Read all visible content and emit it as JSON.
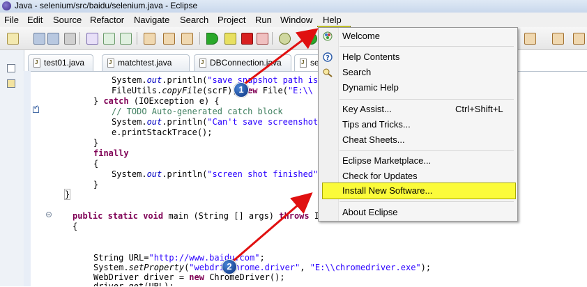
{
  "window": {
    "title": "Java - selenium/src/baidu/selenium.java - Eclipse"
  },
  "menubar": {
    "items": [
      "File",
      "Edit",
      "Source",
      "Refactor",
      "Navigate",
      "Search",
      "Project",
      "Run",
      "Window",
      "Help"
    ]
  },
  "tabs": [
    {
      "label": "test01.java"
    },
    {
      "label": "matchtest.java"
    },
    {
      "label": "DBConnection.java"
    },
    {
      "label": "sel"
    }
  ],
  "code": {
    "l1_a": "System.",
    "l1_b": "out",
    "l1_c": ".println(",
    "l1_d": "\"save snapshot path is:",
    "l2_a": "FileUtils.",
    "l2_b": "copyFile",
    "l2_c": "(scrF",
    "l2_d": "), ",
    "l2_e": "new",
    "l2_f": " File(",
    "l2_g": "\"E:\\\\",
    "l3_a": "} ",
    "l3_b": "catch",
    "l3_c": " (IOException e) {",
    "l4": "// TODO Auto-generated catch block",
    "l5_a": "System.",
    "l5_b": "out",
    "l5_c": ".println(",
    "l5_d": "\"Can't save screenshot\"",
    "l6": "e.printStackTrace();",
    "l7": "}",
    "l8": "finally",
    "l9": "{",
    "l10_a": "System.",
    "l10_b": "out",
    "l10_c": ".println(",
    "l10_d": "\"screen shot finished\"",
    "l10_e": ")",
    "l11": "}",
    "l12": "}",
    "l13_a": "public",
    "l13_b": "static",
    "l13_c": "void",
    "l13_d": " main (String [] args) ",
    "l13_e": "throws",
    "l13_f": " In",
    "l14": "{",
    "l15_a": "String URL=",
    "l15_b": "\"http://www.baidu.com\"",
    "l15_c": ";",
    "l16_a": "System.",
    "l16_b": "setProperty",
    "l16_c": "(",
    "l16_d": "\"webdri",
    "l16_e": ".chrome.driver\"",
    "l16_f": ", ",
    "l16_g": "\"E:\\\\chromedriver.exe\"",
    "l16_h": ");",
    "l17_a": "WebDriver driver = ",
    "l17_b": "new",
    "l17_c": " ChromeDriver();",
    "l18": "driver.get(URL);"
  },
  "help_menu": {
    "items": [
      {
        "label": "Welcome",
        "icon": "welcome-icon"
      },
      {
        "label": "Help Contents",
        "icon": "help-contents-icon"
      },
      {
        "label": "Search",
        "icon": "help-search-icon"
      },
      {
        "label": "Dynamic Help",
        "icon": ""
      },
      {
        "label": "Key Assist...",
        "accel": "Ctrl+Shift+L"
      },
      {
        "label": "Tips and Tricks..."
      },
      {
        "label": "Cheat Sheets..."
      },
      {
        "label": "Eclipse Marketplace..."
      },
      {
        "label": "Check for Updates"
      },
      {
        "label": "Install New Software..."
      },
      {
        "label": "About Eclipse"
      }
    ]
  },
  "annotations": {
    "badge1": "1",
    "badge2": "2"
  },
  "colors": {
    "highlight": "#fbfb3a",
    "arrow": "#e01010",
    "badge": "#1a4fa8",
    "keyword": "#7f0055",
    "string": "#2a00ff",
    "comment": "#3f7f5f"
  }
}
